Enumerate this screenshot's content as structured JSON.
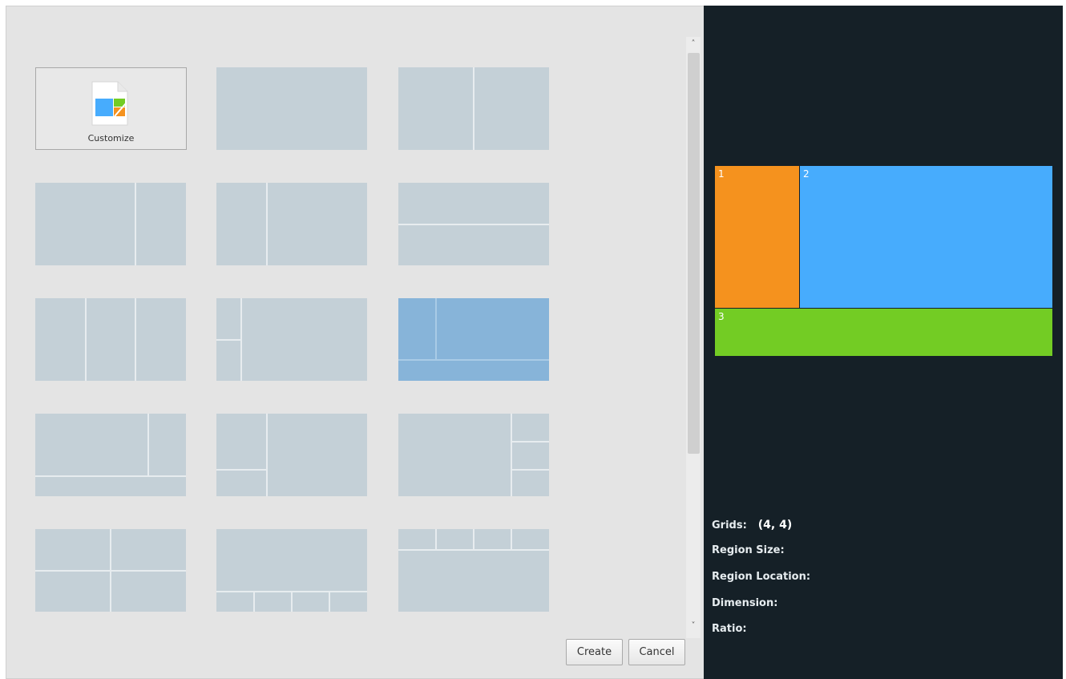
{
  "templates": {
    "customize_label": "Customize",
    "selected_index": 7
  },
  "buttons": {
    "create_label": "Create",
    "cancel_label": "Cancel"
  },
  "scrollbar": {
    "up_arrow": "˄",
    "down_arrow": "˅"
  },
  "preview": {
    "regions": [
      {
        "number": "1",
        "color": "#f5921e"
      },
      {
        "number": "2",
        "color": "#47acfd"
      },
      {
        "number": "3",
        "color": "#73cc24"
      }
    ]
  },
  "info": {
    "grids_label": "Grids:",
    "grids_value": "(4, 4)",
    "region_size_label": "Region Size:",
    "region_location_label": "Region Location:",
    "dimension_label": "Dimension:",
    "ratio_label": "Ratio:"
  }
}
